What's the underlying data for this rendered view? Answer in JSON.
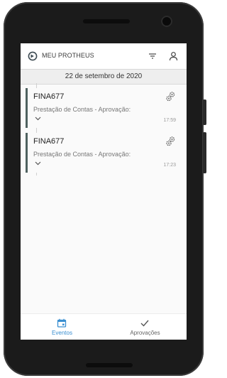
{
  "header": {
    "title": "MEU PROTHEUS",
    "logo_icon": "protheus-logo-icon",
    "filter_icon": "filter-icon",
    "user_icon": "user-icon"
  },
  "date_header": "22 de setembro de 2020",
  "events": [
    {
      "title": "FINA677",
      "description": "Prestação de Contas - Aprovação:",
      "time": "17:59",
      "icon": "gears-icon"
    },
    {
      "title": "FINA677",
      "description": "Prestação de Contas - Aprovação:",
      "time": "17:23",
      "icon": "gears-icon"
    }
  ],
  "bottom_nav": {
    "events_label": "Eventos",
    "approvals_label": "Aprovações",
    "active": "Eventos"
  },
  "colors": {
    "accent": "#3a8fd1",
    "card_bar": "#4f6260",
    "phone_body": "#1b1b1b"
  }
}
